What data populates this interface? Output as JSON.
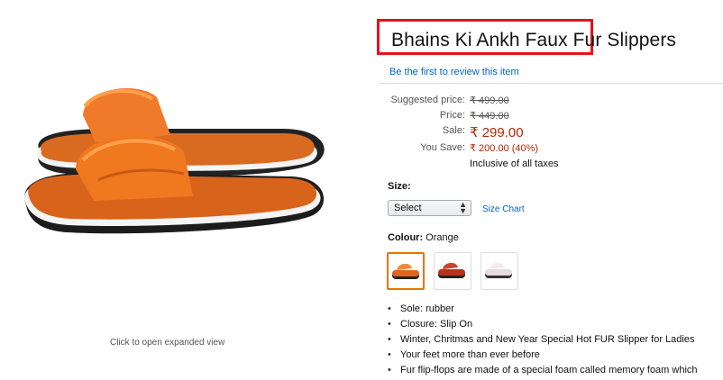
{
  "gallery": {
    "image_alt": "Orange fur slippers",
    "expand_text": "Click to open expanded view"
  },
  "product": {
    "title": "Bhains Ki Ankh Faux Fur Slippers",
    "review_link": "Be the first to review this item"
  },
  "pricing": {
    "suggested_label": "Suggested price:",
    "suggested_value": "₹ 499.00",
    "price_label": "Price:",
    "price_value": "₹ 449.00",
    "sale_label": "Sale:",
    "sale_value": "₹ 299.00",
    "save_label": "You Save:",
    "save_value": "₹ 200.00 (40%)",
    "tax_note": "Inclusive of all taxes"
  },
  "size": {
    "label": "Size:",
    "selected": "Select",
    "size_chart_link": "Size Chart"
  },
  "colour": {
    "label": "Colour:",
    "value": "Orange",
    "swatches": [
      "orange",
      "red",
      "white"
    ]
  },
  "features": [
    "Sole: rubber",
    "Closure: Slip On",
    "Winter, Chritmas and New Year Special Hot FUR Slipper for Ladies",
    "Your feet more than ever before",
    "Fur flip-flops are made of a special foam called memory foam which"
  ],
  "colors": {
    "highlight": "#e4121a",
    "link": "#0066c0",
    "price_red": "#b12704",
    "swatch_selected": "#e77600"
  }
}
